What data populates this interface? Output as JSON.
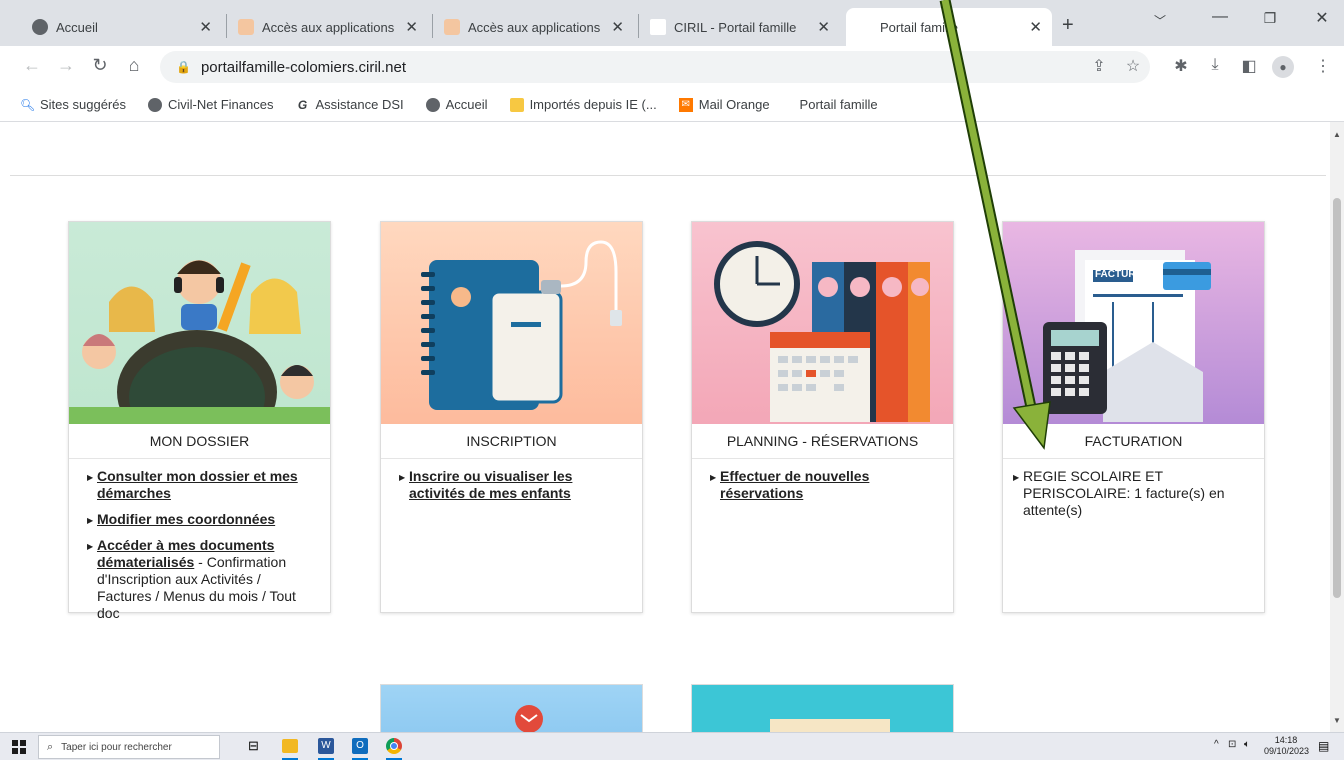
{
  "tabs": [
    {
      "title": "Accueil",
      "active": false
    },
    {
      "title": "Accès aux applications",
      "active": false
    },
    {
      "title": "Accès aux applications",
      "active": false
    },
    {
      "title": "CIRIL - Portail famille",
      "active": false
    },
    {
      "title": "Portail famille",
      "active": true
    }
  ],
  "toolbar": {
    "url": "portailfamille-colomiers.ciril.net"
  },
  "bookmarks": [
    {
      "label": "Sites suggérés",
      "icon": "search-icon"
    },
    {
      "label": "Civil-Net Finances",
      "icon": "globe-icon"
    },
    {
      "label": "Assistance DSI",
      "icon": "g-logo-icon"
    },
    {
      "label": "Accueil",
      "icon": "globe-icon"
    },
    {
      "label": "Importés depuis IE (...",
      "icon": "folder-icon"
    },
    {
      "label": "Mail Orange",
      "icon": "mail-icon"
    },
    {
      "label": "Portail famille",
      "icon": "none"
    }
  ],
  "cards": [
    {
      "title": "MON DOSSIER",
      "links": [
        {
          "link": "Consulter mon dossier et mes démarches",
          "rest": ""
        },
        {
          "link": "Modifier mes coordonnées",
          "rest": ""
        },
        {
          "link": "Accéder à mes documents dématerialisés",
          "rest": " - Confirmation d'Inscription aux Activités / Factures / Menus du mois / Tout doc"
        }
      ]
    },
    {
      "title": "INSCRIPTION",
      "links": [
        {
          "link": "Inscrire ou visualiser les activités de mes enfants",
          "rest": ""
        }
      ]
    },
    {
      "title": "PLANNING - RÉSERVATIONS",
      "links": [
        {
          "link": "Effectuer de nouvelles réservations",
          "rest": ""
        }
      ]
    },
    {
      "title": "FACTURATION",
      "text": "REGIE SCOLAIRE ET PERISCOLAIRE: 1 facture(s) en attente(s)"
    }
  ],
  "invoice_image_text": "FACTURE",
  "taskbar": {
    "search_placeholder": "Taper ici pour rechercher",
    "time": "14:18",
    "date": "09/10/2023"
  },
  "colors": {
    "arrow": "#8ab23a",
    "tab_strip": "#dee1e6"
  }
}
